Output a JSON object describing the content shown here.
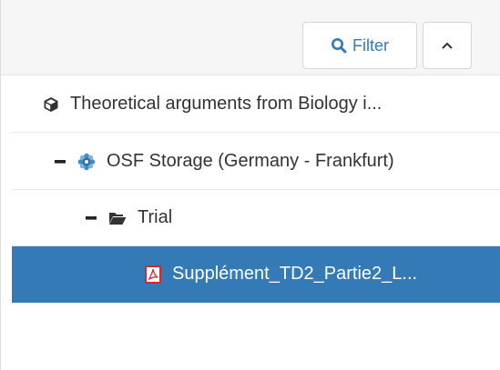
{
  "toolbar": {
    "filter_label": "Filter",
    "filter_icon": "search-icon",
    "collapse_icon": "chevron-up-icon"
  },
  "tree": {
    "project": {
      "label": "Theoretical arguments from Biology i...",
      "icon": "cube-icon"
    },
    "storage": {
      "toggle": "–",
      "label": "OSF Storage (Germany - Frankfurt)",
      "icon": "storage-gear-icon"
    },
    "folder": {
      "toggle": "–",
      "label": "Trial",
      "icon": "folder-open-icon"
    },
    "file": {
      "label": "Supplément_TD2_Partie2_L...",
      "icon": "pdf-file-icon",
      "selected": true
    }
  },
  "colors": {
    "accent": "#337ab7",
    "toolbar_bg": "#f6f6f6",
    "pdf_red": "#d9262a"
  }
}
